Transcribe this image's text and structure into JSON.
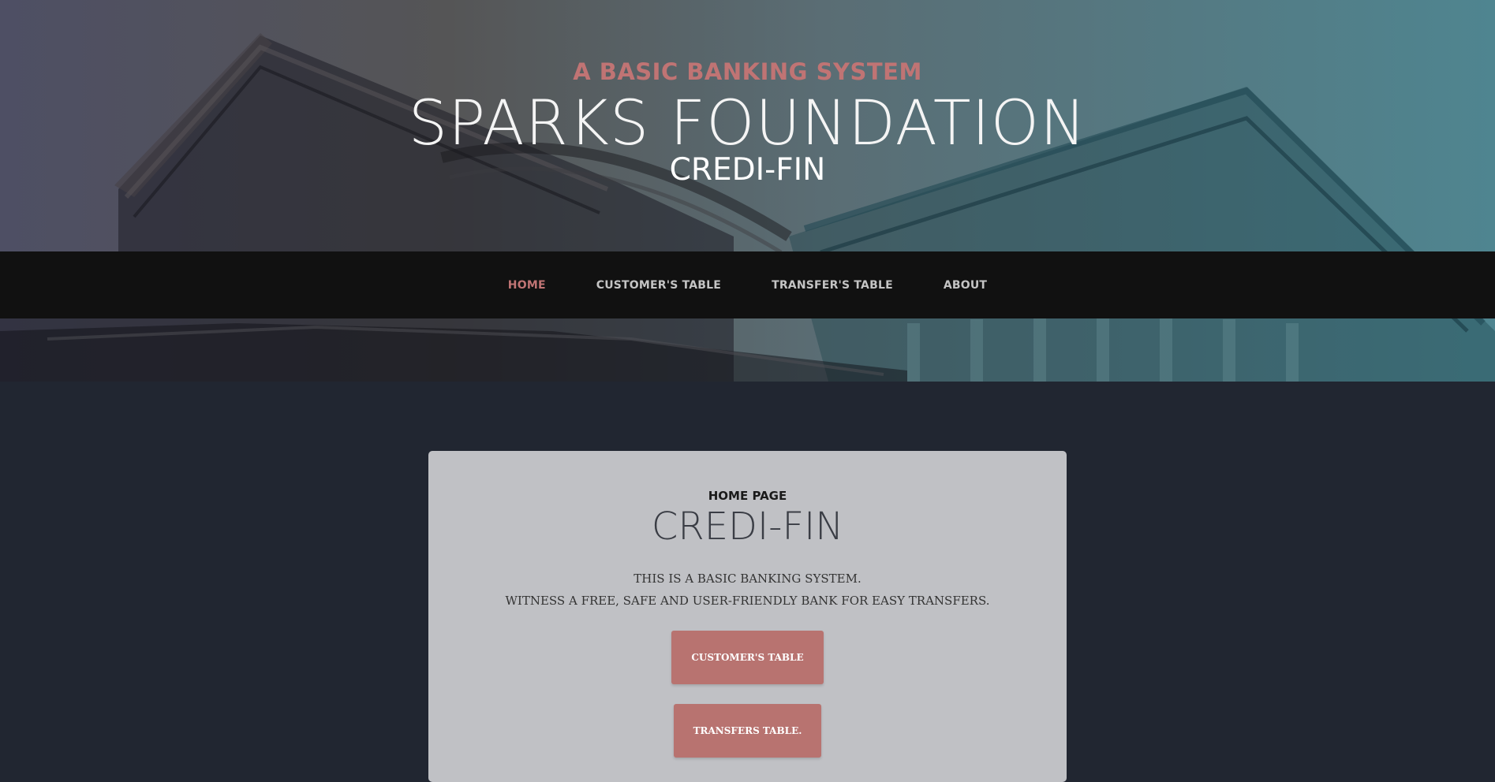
{
  "hero": {
    "subtitle": "A BASIC BANKING SYSTEM",
    "title": "SPARKS FOUNDATION",
    "brand": "CREDI-FIN",
    "gradient_colors": [
      "#4e4f64",
      "#555556",
      "#5a6d74",
      "#4f8590"
    ]
  },
  "nav": {
    "items": [
      {
        "label": "HOME",
        "active": true
      },
      {
        "label": "CUSTOMER'S TABLE",
        "active": false
      },
      {
        "label": "TRANSFER'S TABLE",
        "active": false
      },
      {
        "label": "ABOUT",
        "active": false
      }
    ],
    "active_color": "#c07474"
  },
  "card": {
    "eyebrow": "HOME PAGE",
    "title": "CREDI-FIN",
    "line1": "THIS IS A BASIC BANKING SYSTEM.",
    "line2": "WITNESS A FREE, SAFE AND USER-FRIENDLY BANK FOR EASY TRANSFERS.",
    "buttons": [
      {
        "label": "CUSTOMER'S TABLE"
      },
      {
        "label": "TRANSFERS TABLE."
      }
    ],
    "button_color": "#b87370"
  },
  "colors": {
    "page_background": "#212631",
    "navbar_background": "#111111",
    "card_background": "#c0c1c5"
  }
}
